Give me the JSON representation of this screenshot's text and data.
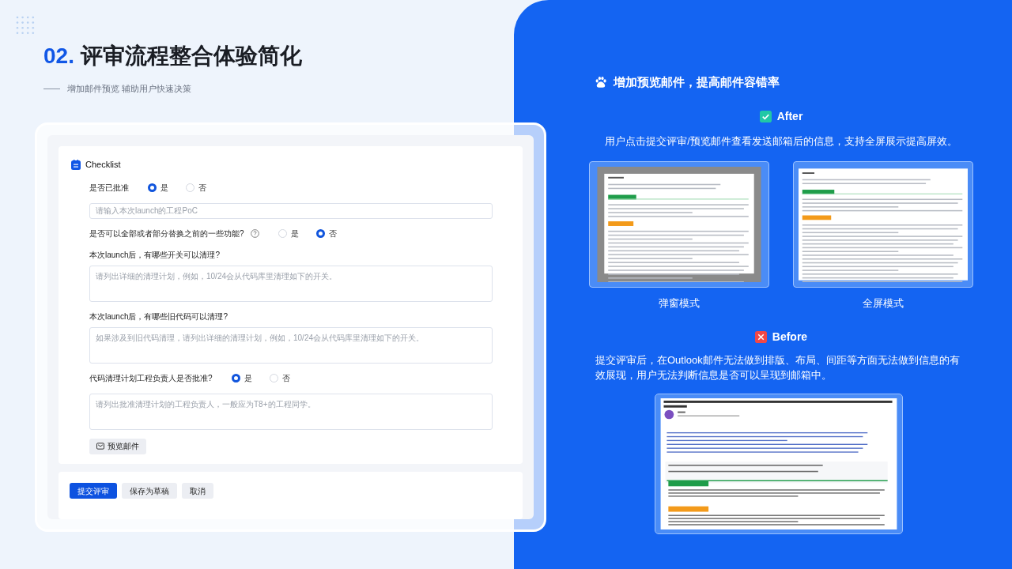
{
  "slide": {
    "number": "02.",
    "title": "评审流程整合体验简化",
    "subtitle": "增加邮件预览 辅助用户快速决策"
  },
  "form": {
    "title": "Checklist",
    "questions": [
      {
        "kind": "radio",
        "label": "是否已批准",
        "help": false,
        "options": [
          {
            "label": "是",
            "selected": true
          },
          {
            "label": "否",
            "selected": false
          }
        ]
      },
      {
        "kind": "input",
        "placeholder": "请输入本次launch的工程PoC"
      },
      {
        "kind": "radio",
        "label": "是否可以全部或者部分替换之前的一些功能?",
        "help": true,
        "options": [
          {
            "label": "是",
            "selected": false
          },
          {
            "label": "否",
            "selected": true
          }
        ]
      },
      {
        "kind": "textarea",
        "label": "本次launch后，有哪些开关可以清理?",
        "placeholder": "请列出详细的清理计划，例如，10/24会从代码库里清理如下的开关。"
      },
      {
        "kind": "textarea",
        "label": "本次launch后，有哪些旧代码可以清理?",
        "placeholder": "如果涉及到旧代码清理，请列出详细的清理计划，例如，10/24会从代码库里清理如下的开关。"
      },
      {
        "kind": "radio",
        "label": "代码清理计划工程负责人是否批准?",
        "help": false,
        "options": [
          {
            "label": "是",
            "selected": true
          },
          {
            "label": "否",
            "selected": false
          }
        ]
      },
      {
        "kind": "textarea",
        "placeholder": "请列出批准清理计划的工程负责人，一般应为T8+的工程同学。"
      }
    ],
    "preview_button": "预览邮件",
    "actions": [
      {
        "label": "提交评审",
        "primary": true
      },
      {
        "label": "保存为草稿",
        "primary": false
      },
      {
        "label": "取消",
        "primary": false
      }
    ]
  },
  "panel": {
    "heading": "增加预览邮件，提高邮件容错率",
    "after": {
      "label": "After",
      "description": "用户点击提交评审/预览邮件查看发送邮箱后的信息，支持全屏展示提高屏效。",
      "previews": [
        {
          "kind": "modal",
          "caption": "弹窗模式"
        },
        {
          "kind": "fullscreen",
          "caption": "全屏模式"
        }
      ]
    },
    "before": {
      "label": "Before",
      "description": "提交评审后，在Outlook邮件无法做到排版、布局、间距等方面无法做到信息的有效展现，用户无法判断信息是否可以呈现到邮箱中。",
      "kind": "email"
    }
  }
}
